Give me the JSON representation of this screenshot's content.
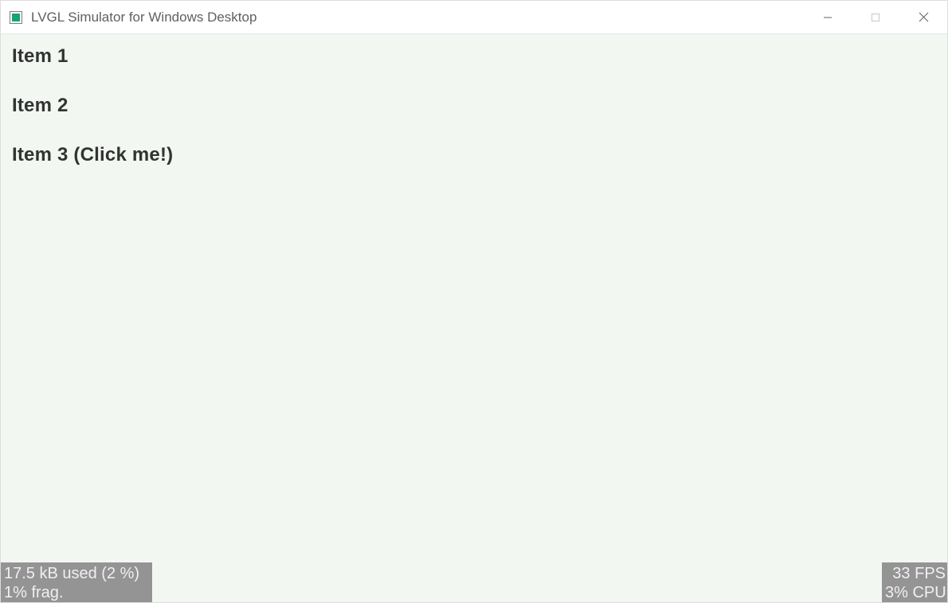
{
  "window": {
    "title": "LVGL Simulator for Windows Desktop"
  },
  "list": {
    "items": [
      {
        "label": "Item 1"
      },
      {
        "label": "Item 2"
      },
      {
        "label": "Item 3 (Click me!)"
      }
    ]
  },
  "stats": {
    "memory_line1": "17.5 kB used (2 %)",
    "memory_line2": "1% frag.",
    "perf_line1": "33 FPS",
    "perf_line2": "3% CPU"
  }
}
